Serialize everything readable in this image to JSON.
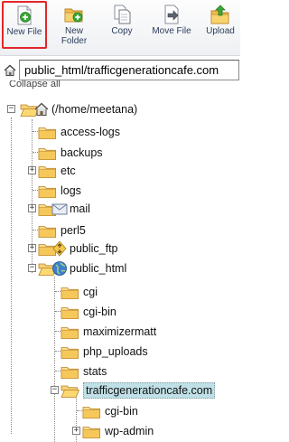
{
  "toolbar": {
    "new_file": "New File",
    "new_folder_line1": "New",
    "new_folder_line2": "Folder",
    "copy": "Copy",
    "move_file": "Move File",
    "upload": "Upload"
  },
  "path": {
    "value": "public_html/trafficgenerationcafe.com"
  },
  "tree": {
    "collapse_all": "Collapse all",
    "root": "(/home/meetana)",
    "items": [
      "access-logs",
      "backups",
      "etc",
      "logs",
      "mail",
      "perl5",
      "public_ftp",
      "public_html",
      "cgi",
      "cgi-bin",
      "maximizermatt",
      "php_uploads",
      "stats",
      "trafficgenerationcafe.com",
      "cgi-bin",
      "wp-admin"
    ]
  },
  "colors": {
    "highlight": "#e3262b",
    "selection": "#bfe0e6",
    "folder": "#f3c24f"
  }
}
